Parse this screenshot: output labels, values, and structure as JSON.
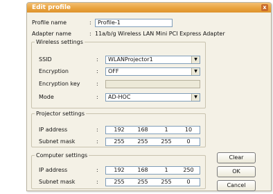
{
  "window": {
    "title": "Edit profile",
    "close_glyph": "x"
  },
  "profile": {
    "name_label": "Profile name",
    "name_value": "Profile-1",
    "adapter_label": "Adapter name",
    "adapter_value": "11a/b/g Wireless LAN Mini PCI Express Adapter"
  },
  "wireless": {
    "legend": "Wireless settings",
    "ssid_label": "SSID",
    "ssid_value": "WLANProjector1",
    "encryption_label": "Encryption",
    "encryption_value": "OFF",
    "key_label": "Encryption key",
    "key_value": "",
    "mode_label": "Mode",
    "mode_value": "AD-HOC"
  },
  "projector": {
    "legend": "Projector settings",
    "ip_label": "IP address",
    "ip": [
      "192",
      "168",
      "1",
      "10"
    ],
    "mask_label": "Subnet mask",
    "mask": [
      "255",
      "255",
      "255",
      "0"
    ]
  },
  "computer": {
    "legend": "Computer settings",
    "ip_label": "IP address",
    "ip": [
      "192",
      "168",
      "1",
      "250"
    ],
    "mask_label": "Subnet mask",
    "mask": [
      "255",
      "255",
      "255",
      "0"
    ]
  },
  "buttons": {
    "clear": "Clear",
    "ok": "OK",
    "cancel": "Cancel"
  },
  "colon": ":",
  "icons": {
    "dropdown": "dropdown-arrow-icon",
    "close": "close-icon"
  }
}
